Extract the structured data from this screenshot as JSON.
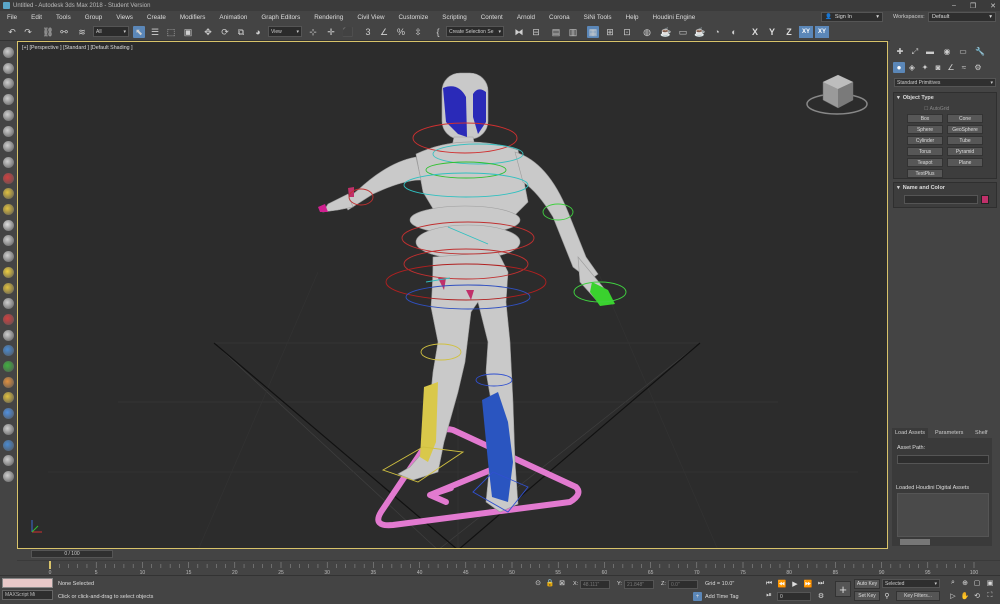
{
  "window": {
    "title": "Untitled - Autodesk 3ds Max 2018 - Student Version"
  },
  "menu": [
    "File",
    "Edit",
    "Tools",
    "Group",
    "Views",
    "Create",
    "Modifiers",
    "Animation",
    "Graph Editors",
    "Rendering",
    "Civil View",
    "Customize",
    "Scripting",
    "Content",
    "Arnold",
    "Corona",
    "SiNi Tools",
    "Help",
    "Houdini Engine"
  ],
  "account": {
    "signin": "Sign In",
    "workspaces_label": "Workspaces:",
    "workspace": "Default"
  },
  "toolbar": {
    "filter": "All",
    "refcoord": "View",
    "selection_set": "Create Selection Se",
    "snap_angle": "3",
    "axis_x": "X",
    "axis_y": "Y",
    "axis_z": "Z",
    "axis_xy": "XY",
    "axis_xy2": "XY"
  },
  "viewport": {
    "label": "[+] [Perspective ] [Standard ] [Default Shading ]"
  },
  "command_panel": {
    "category": "Standard Primitives",
    "object_type_title": "Object Type",
    "autogrid": "AutoGrid",
    "objects": [
      "Box",
      "Cone",
      "Sphere",
      "GeoSphere",
      "Cylinder",
      "Tube",
      "Torus",
      "Pyramid",
      "Teapot",
      "Plane",
      "TextPlus"
    ],
    "name_color_title": "Name and Color",
    "object_color": "#c0306a"
  },
  "houdini_panel": {
    "tabs": [
      "Load Assets",
      "Parameters",
      "Shelf"
    ],
    "asset_path_label": "Asset Path:",
    "loaded_label": "Loaded Houdini Digital Assets"
  },
  "timeline": {
    "frame": "0 / 100",
    "ticks": [
      "0",
      "5",
      "10",
      "15",
      "20",
      "25",
      "30",
      "35",
      "40",
      "45",
      "50",
      "55",
      "60",
      "65",
      "70",
      "75",
      "80",
      "85",
      "90",
      "95",
      "100"
    ]
  },
  "status": {
    "maxscript": "MAXScript Mi",
    "selection": "None Selected",
    "prompt": "Click or click-and-drag to select objects",
    "x_label": "X:",
    "x_value": "48.111\"",
    "y_label": "Y:",
    "y_value": "21.848\"",
    "z_label": "Z:",
    "z_value": "0.0\"",
    "grid": "Grid = 10.0\"",
    "add_time_tag": "Add Time Tag",
    "auto_key": "Auto Key",
    "set_key": "Set Key",
    "selected": "Selected",
    "key_filters": "Key Filters...",
    "current_frame": "0"
  },
  "colors": {
    "accent": "#5b87b8",
    "viewport_bg": "#2c2c2c",
    "ui_bg": "#444444",
    "active_border": "#d8c36a"
  }
}
